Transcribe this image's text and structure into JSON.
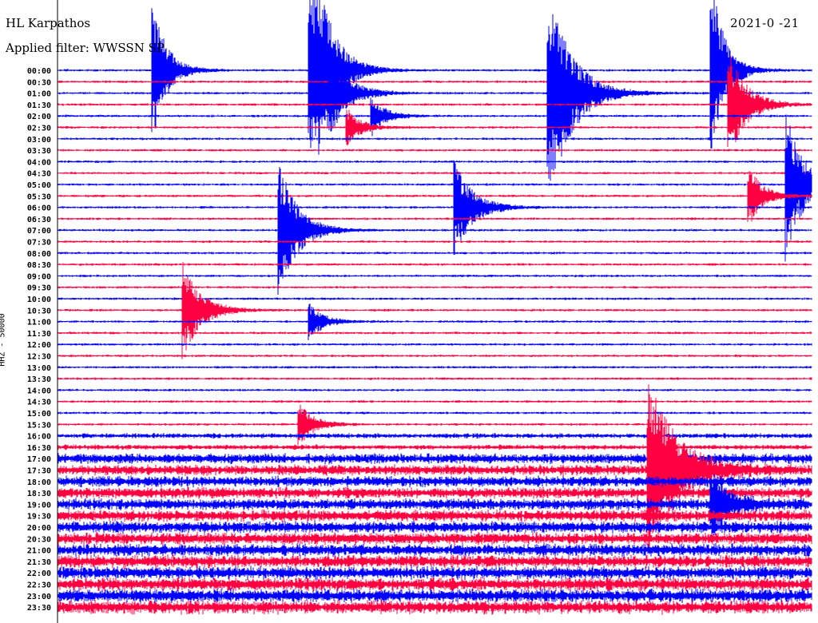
{
  "header": {
    "station": "HL Karpathos",
    "filter": "Applied filter: WWSSN SP",
    "date": "2021-0 -21",
    "channel_label": "HHZ - 50000"
  },
  "chart_data": {
    "type": "line",
    "title": "HL Karpathos",
    "subtitle": "Applied filter: WWSSN SP",
    "ylabel": "HHZ - 50000",
    "minutes_per_line": 30,
    "colors": [
      "#0000ff",
      "#ff0040"
    ],
    "row_labels": [
      "00:00",
      "00:30",
      "01:00",
      "01:30",
      "02:00",
      "02:30",
      "03:00",
      "03:30",
      "04:00",
      "04:30",
      "05:00",
      "05:30",
      "06:00",
      "06:30",
      "07:00",
      "07:30",
      "08:00",
      "08:30",
      "09:00",
      "09:30",
      "10:00",
      "10:30",
      "11:00",
      "11:30",
      "12:00",
      "12:30",
      "13:00",
      "13:30",
      "14:00",
      "14:30",
      "15:00",
      "15:30",
      "16:00",
      "16:30",
      "17:00",
      "17:30",
      "18:00",
      "18:30",
      "19:00",
      "19:30",
      "20:00",
      "20:30",
      "21:00",
      "21:30",
      "22:00",
      "22:30",
      "23:00",
      "23:30"
    ],
    "noise_level": {
      "quiet_until": "16:30",
      "quiet": 1,
      "noisy": 4
    },
    "events": [
      {
        "line": "00:00",
        "minute": 3.8,
        "amplitude": 90,
        "duration": 1.5
      },
      {
        "line": "00:00",
        "minute": 10.0,
        "amplitude": 200,
        "duration": 2
      },
      {
        "line": "00:00",
        "minute": 26.0,
        "amplitude": 120,
        "duration": 1.5
      },
      {
        "line": "01:00",
        "minute": 10.8,
        "amplitude": 60,
        "duration": 2
      },
      {
        "line": "01:00",
        "minute": 19.5,
        "amplitude": 150,
        "duration": 2.5
      },
      {
        "line": "01:30",
        "minute": 26.7,
        "amplitude": 70,
        "duration": 2
      },
      {
        "line": "02:00",
        "minute": 12.5,
        "amplitude": 25,
        "duration": 1.5
      },
      {
        "line": "02:30",
        "minute": 11.5,
        "amplitude": 25,
        "duration": 1.5
      },
      {
        "line": "05:00",
        "minute": 29.0,
        "amplitude": 90,
        "duration": 2
      },
      {
        "line": "05:30",
        "minute": 27.5,
        "amplitude": 40,
        "duration": 1.5
      },
      {
        "line": "06:00",
        "minute": 15.8,
        "amplitude": 60,
        "duration": 2
      },
      {
        "line": "07:00",
        "minute": 8.8,
        "amplitude": 90,
        "duration": 2
      },
      {
        "line": "10:30",
        "minute": 5.0,
        "amplitude": 60,
        "duration": 2
      },
      {
        "line": "11:00",
        "minute": 10.0,
        "amplitude": 25,
        "duration": 1.5
      },
      {
        "line": "15:30",
        "minute": 9.6,
        "amplitude": 30,
        "duration": 1.5
      },
      {
        "line": "17:30",
        "minute": 23.5,
        "amplitude": 120,
        "duration": 3
      },
      {
        "line": "19:00",
        "minute": 26.0,
        "amplitude": 40,
        "duration": 2
      }
    ]
  }
}
